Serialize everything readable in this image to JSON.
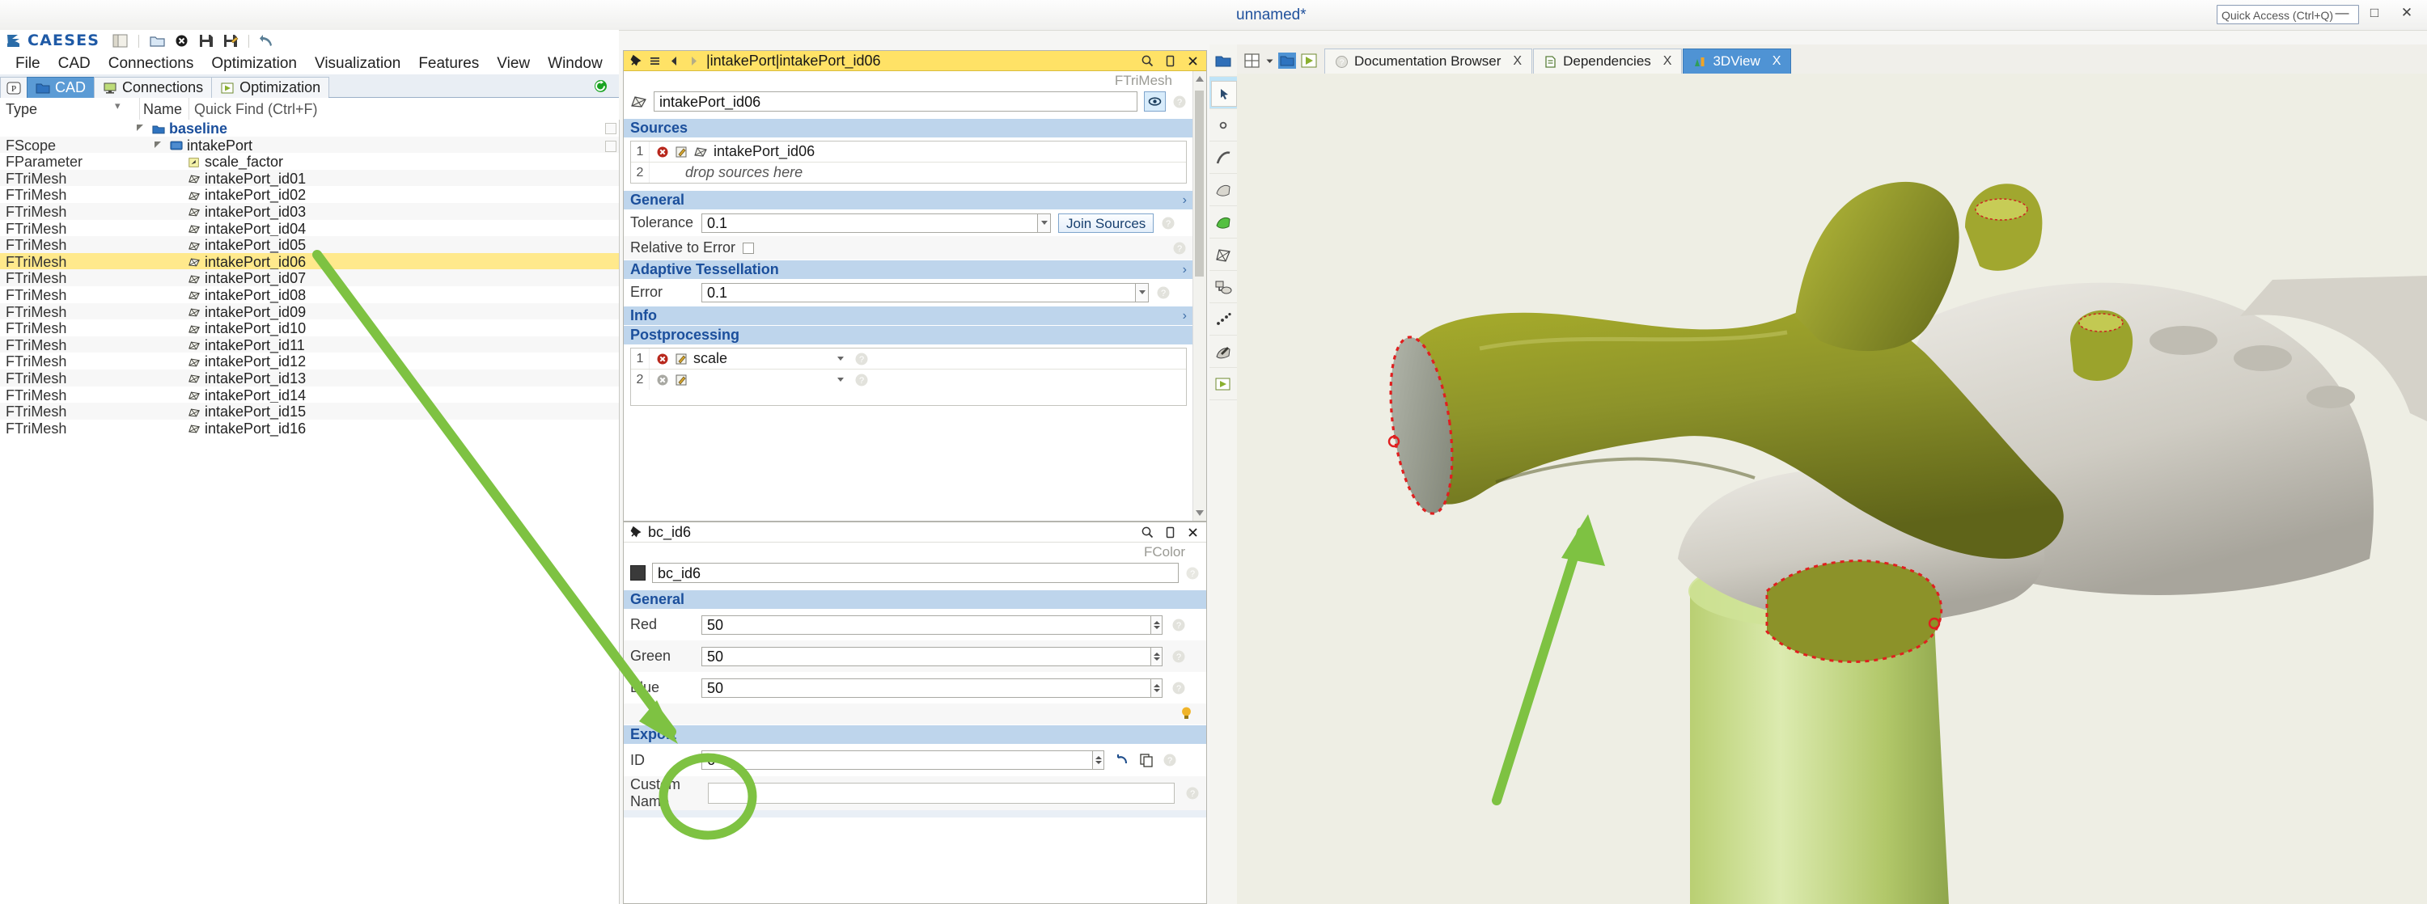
{
  "window": {
    "doc_title": "unnamed*",
    "quick_access_placeholder": "Quick Access (Ctrl+Q)",
    "minimize": "—",
    "maximize": "□",
    "close": "✕"
  },
  "brand": {
    "name": "CAESES",
    "logo_icon": "caeses-logo-icon"
  },
  "toolbar": {
    "icons": [
      {
        "name": "layout-panels-icon",
        "glyph": "panels"
      },
      {
        "name": "separator",
        "glyph": "sep"
      },
      {
        "name": "open-folder-icon",
        "glyph": "folder"
      },
      {
        "name": "close-project-icon",
        "glyph": "close-circle"
      },
      {
        "name": "save-icon",
        "glyph": "save"
      },
      {
        "name": "save-as-icon",
        "glyph": "save-as"
      },
      {
        "name": "separator",
        "glyph": "sep"
      },
      {
        "name": "undo-icon",
        "glyph": "undo"
      }
    ]
  },
  "menu": {
    "items": [
      "File",
      "CAD",
      "Connections",
      "Optimization",
      "Visualization",
      "Features",
      "View",
      "Window"
    ],
    "trailing_icons": [
      "help-icon",
      "copy-icon",
      "paste-icon",
      "cancel-icon",
      "person-icon"
    ]
  },
  "left_tabs": {
    "items": [
      {
        "label": "",
        "icon": "parameter-p-icon",
        "selected": false
      },
      {
        "label": "CAD",
        "icon": "cad-folder-icon",
        "selected": true
      },
      {
        "label": "Connections",
        "icon": "connections-monitor-icon",
        "selected": false
      },
      {
        "label": "Optimization",
        "icon": "optimization-play-icon",
        "selected": false
      }
    ],
    "status_icon": "refresh-green-icon"
  },
  "tree_header": {
    "type_col": "Type",
    "name_col": "Name",
    "quick_find": "Quick Find (Ctrl+F)"
  },
  "tree": {
    "rows": [
      {
        "type": "",
        "name": "baseline",
        "icon": "folder-blue-icon",
        "indent": 0,
        "arrow": true,
        "bold": true,
        "selected": false
      },
      {
        "type": "FScope",
        "name": "intakePort",
        "icon": "folder-scope-icon",
        "indent": 1,
        "arrow": true,
        "bold": false,
        "selected": false
      },
      {
        "type": "FParameter",
        "name": "scale_factor",
        "icon": "parameter-icon",
        "indent": 2,
        "arrow": false,
        "bold": false,
        "selected": false
      },
      {
        "type": "FTriMesh",
        "name": "intakePort_id01",
        "icon": "trimesh-icon",
        "indent": 2,
        "arrow": false,
        "bold": false,
        "selected": false
      },
      {
        "type": "FTriMesh",
        "name": "intakePort_id02",
        "icon": "trimesh-icon",
        "indent": 2,
        "arrow": false,
        "bold": false,
        "selected": false
      },
      {
        "type": "FTriMesh",
        "name": "intakePort_id03",
        "icon": "trimesh-icon",
        "indent": 2,
        "arrow": false,
        "bold": false,
        "selected": false
      },
      {
        "type": "FTriMesh",
        "name": "intakePort_id04",
        "icon": "trimesh-icon",
        "indent": 2,
        "arrow": false,
        "bold": false,
        "selected": false
      },
      {
        "type": "FTriMesh",
        "name": "intakePort_id05",
        "icon": "trimesh-icon",
        "indent": 2,
        "arrow": false,
        "bold": false,
        "selected": false
      },
      {
        "type": "FTriMesh",
        "name": "intakePort_id06",
        "icon": "trimesh-icon",
        "indent": 2,
        "arrow": false,
        "bold": false,
        "selected": true
      },
      {
        "type": "FTriMesh",
        "name": "intakePort_id07",
        "icon": "trimesh-icon",
        "indent": 2,
        "arrow": false,
        "bold": false,
        "selected": false
      },
      {
        "type": "FTriMesh",
        "name": "intakePort_id08",
        "icon": "trimesh-icon",
        "indent": 2,
        "arrow": false,
        "bold": false,
        "selected": false
      },
      {
        "type": "FTriMesh",
        "name": "intakePort_id09",
        "icon": "trimesh-icon",
        "indent": 2,
        "arrow": false,
        "bold": false,
        "selected": false
      },
      {
        "type": "FTriMesh",
        "name": "intakePort_id10",
        "icon": "trimesh-icon",
        "indent": 2,
        "arrow": false,
        "bold": false,
        "selected": false
      },
      {
        "type": "FTriMesh",
        "name": "intakePort_id11",
        "icon": "trimesh-icon",
        "indent": 2,
        "arrow": false,
        "bold": false,
        "selected": false
      },
      {
        "type": "FTriMesh",
        "name": "intakePort_id12",
        "icon": "trimesh-icon",
        "indent": 2,
        "arrow": false,
        "bold": false,
        "selected": false
      },
      {
        "type": "FTriMesh",
        "name": "intakePort_id13",
        "icon": "trimesh-icon",
        "indent": 2,
        "arrow": false,
        "bold": false,
        "selected": false
      },
      {
        "type": "FTriMesh",
        "name": "intakePort_id14",
        "icon": "trimesh-icon",
        "indent": 2,
        "arrow": false,
        "bold": false,
        "selected": false
      },
      {
        "type": "FTriMesh",
        "name": "intakePort_id15",
        "icon": "trimesh-icon",
        "indent": 2,
        "arrow": false,
        "bold": false,
        "selected": false
      },
      {
        "type": "FTriMesh",
        "name": "intakePort_id16",
        "icon": "trimesh-icon",
        "indent": 2,
        "arrow": false,
        "bold": false,
        "selected": false
      }
    ]
  },
  "mesh_panel": {
    "title": "|intakePort|intakePort_id06",
    "type_tag": "FTriMesh",
    "name_value": "intakePort_id06",
    "title_icons": [
      "pin-icon",
      "list-icon",
      "back-arrow-icon",
      "forward-arrow-icon"
    ],
    "title_right_icons": [
      "search-icon",
      "detach-icon",
      "close-icon"
    ],
    "visibility_icon": "eye-icon",
    "sections": {
      "sources": {
        "label": "Sources",
        "rows": [
          {
            "num": "1",
            "delete_icon": "delete-red-icon",
            "edit_icon": "edit-pencil-icon",
            "item_icon": "trimesh-icon",
            "value": "intakePort_id06",
            "ghost": false
          },
          {
            "num": "2",
            "delete_icon": "",
            "edit_icon": "",
            "item_icon": "",
            "value": "drop sources here",
            "ghost": true
          }
        ]
      },
      "general": {
        "label": "General",
        "tolerance_label": "Tolerance",
        "tolerance_value": "0.1",
        "join_sources_label": "Join Sources",
        "relative_to_error_label": "Relative to Error",
        "relative_to_error_checked": false
      },
      "adaptive": {
        "label": "Adaptive Tessellation",
        "error_label": "Error",
        "error_value": "0.1"
      },
      "info": {
        "label": "Info"
      },
      "postprocessing": {
        "label": "Postprocessing",
        "rows": [
          {
            "num": "1",
            "delete_icon": "delete-red-icon",
            "edit_icon": "edit-pencil-icon",
            "value": "scale"
          },
          {
            "num": "2",
            "delete_icon": "delete-grey-icon",
            "edit_icon": "edit-pencil-icon",
            "value": ""
          }
        ]
      }
    }
  },
  "color_panel": {
    "title": "bc_id6",
    "type_tag": "FColor",
    "name_value": "bc_id6",
    "swatch_color": "#3a3a3a",
    "title_icons": [
      "pin-icon"
    ],
    "title_right_icons": [
      "search-icon",
      "detach-icon",
      "close-icon"
    ],
    "general": {
      "label": "General",
      "fields": [
        {
          "label": "Red",
          "value": "50"
        },
        {
          "label": "Green",
          "value": "50"
        },
        {
          "label": "Blue",
          "value": "50"
        }
      ],
      "bulb_icon": "lightbulb-icon"
    },
    "export": {
      "label": "Export",
      "id_label": "ID",
      "id_value": "6",
      "custom_name_label": "Custom Name",
      "custom_name_value": "",
      "reset_icon": "reset-arrow-icon",
      "copy_icon": "copy-icon"
    }
  },
  "right_tabs": {
    "leading_icons": [
      "split-view-icon",
      "chevron-down-icon",
      "cad-folder-icon",
      "optimization-play-icon"
    ],
    "items": [
      {
        "label": "Documentation Browser",
        "icon": "help-circle-icon",
        "selected": false,
        "close": "X"
      },
      {
        "label": "Dependencies",
        "icon": "dependencies-icon",
        "selected": false,
        "close": "X"
      },
      {
        "label": "3DView",
        "icon": "chart-bars-icon",
        "selected": true,
        "close": "X"
      }
    ]
  },
  "view_toolbar": {
    "items": [
      {
        "name": "folder-blue-icon",
        "selected": false
      },
      {
        "name": "cursor-select-icon",
        "selected": true
      },
      {
        "name": "point-icon",
        "selected": false
      },
      {
        "name": "curve-icon",
        "selected": false
      },
      {
        "name": "surface-icon",
        "selected": false
      },
      {
        "name": "solid-green-icon",
        "selected": false
      },
      {
        "name": "trimesh-icon",
        "selected": false
      },
      {
        "name": "group-icon",
        "selected": false
      },
      {
        "name": "pointcloud-icon",
        "selected": false
      },
      {
        "name": "transform-icon",
        "selected": false
      },
      {
        "name": "run-play-icon",
        "selected": false
      }
    ]
  },
  "viewport": {
    "model_name": "intake-port-3d-model",
    "highlight_circle": "export-id-highlight",
    "annotation_arrows": [
      "arrow-to-tree-selection",
      "arrow-to-3d-surface"
    ],
    "colors": {
      "selected_surface": "#8a8f1f",
      "cylinder": "#c8dc82",
      "background": "#eeeee4",
      "grey_body": "#cfcfc8",
      "edge_highlight": "#e02020",
      "annotation_green": "#7ec242"
    }
  }
}
